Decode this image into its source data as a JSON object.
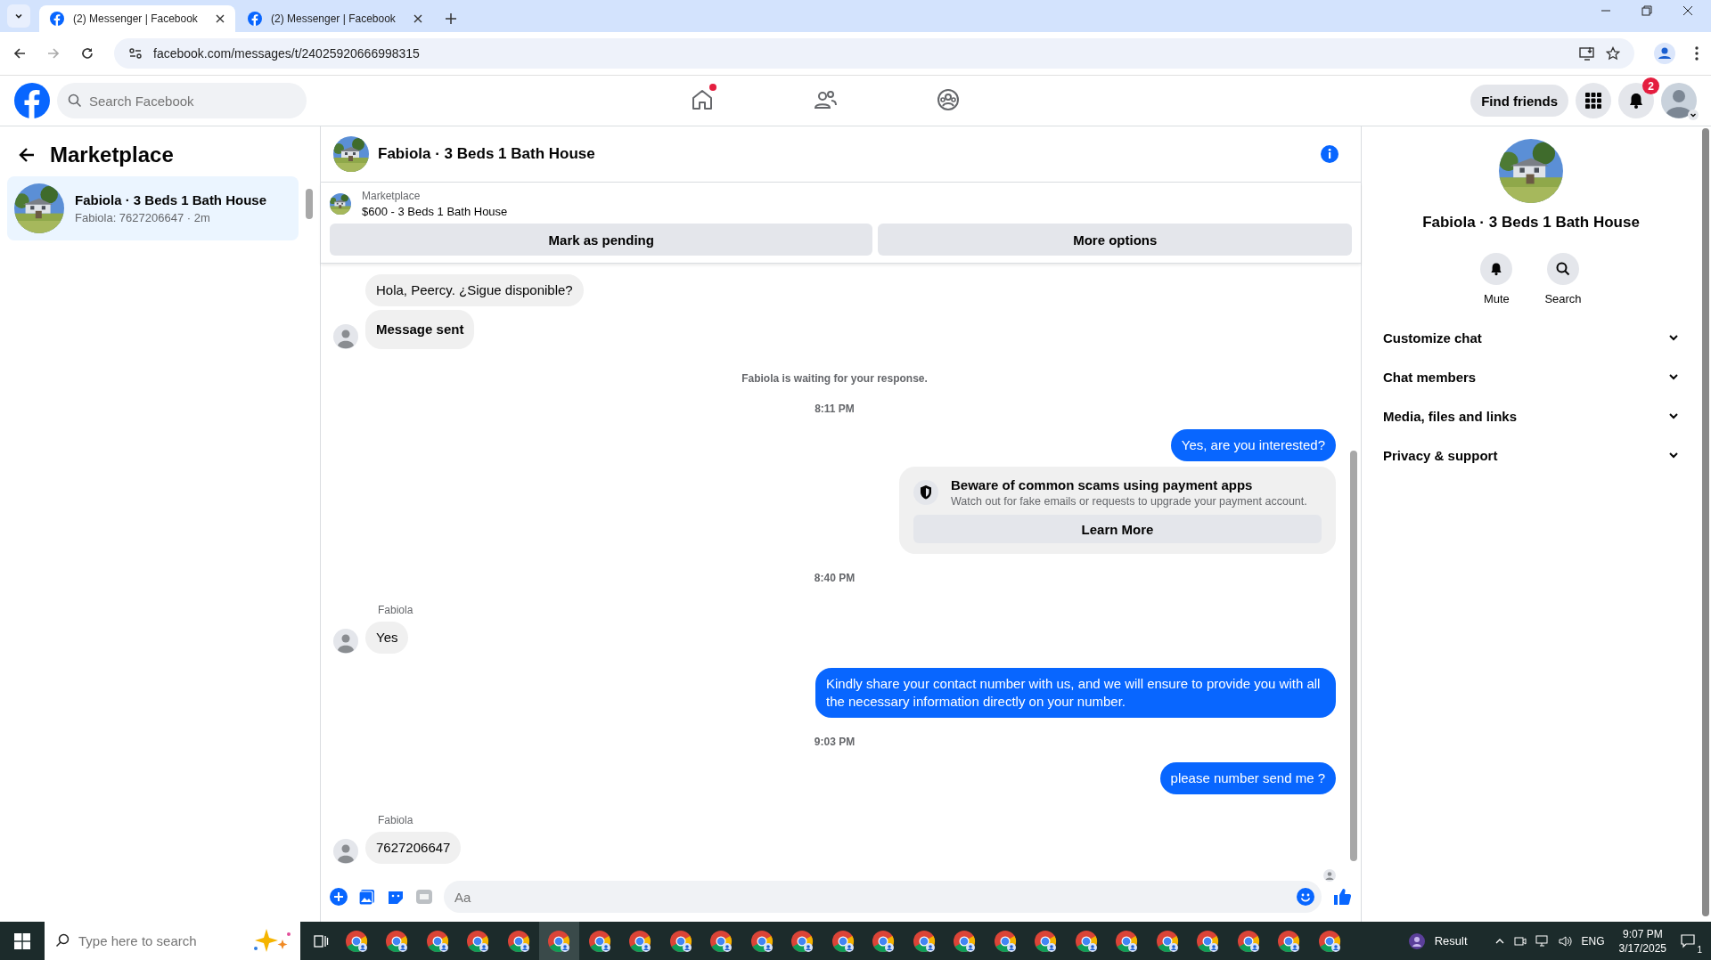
{
  "browser": {
    "tabs": [
      {
        "title": "(2) Messenger | Facebook",
        "selected": true
      },
      {
        "title": "(2) Messenger | Facebook",
        "selected": false
      }
    ],
    "url": "facebook.com/messages/t/24025920666998315"
  },
  "header": {
    "search": {
      "placeholder": "Search Facebook"
    },
    "nav": [
      {
        "kind": "home",
        "selected": false,
        "dot": true
      },
      {
        "kind": "friends",
        "selected": false,
        "dot": false
      },
      {
        "kind": "groups",
        "selected": false,
        "dot": false
      }
    ],
    "find_friends": "Find friends",
    "notifications_badge": "2"
  },
  "sidebar": {
    "title": "Marketplace",
    "conversations": [
      {
        "name": "Fabiola · 3 Beds 1 Bath House",
        "preview": "Fabiola: 7627206647 · 2m",
        "selected": true
      }
    ]
  },
  "chat": {
    "title": "Fabiola · 3 Beds 1 Bath House",
    "listing": {
      "label": "Marketplace",
      "title": "$600 - 3 Beds 1 Bath House",
      "buttons": [
        "Mark as pending",
        "More options"
      ]
    },
    "messages": [
      {
        "kind": "incoming",
        "text": "Hola, Peercy. ¿Sigue disponible?",
        "bold": false,
        "avatar": false
      },
      {
        "kind": "incoming",
        "text": "Message sent",
        "bold": true,
        "avatar": true
      },
      {
        "kind": "notice",
        "text": "Fabiola is waiting for your response."
      },
      {
        "kind": "time",
        "text": "8:11 PM"
      },
      {
        "kind": "outgoing",
        "text": "Yes, are you interested?"
      },
      {
        "kind": "warning",
        "title": "Beware of common scams using payment apps",
        "text": "Watch out for fake emails or requests to upgrade your payment account.",
        "button": "Learn More"
      },
      {
        "kind": "time",
        "text": "8:40 PM"
      },
      {
        "kind": "incoming",
        "sender": "Fabiola",
        "text": "Yes",
        "bold": false,
        "avatar": true
      },
      {
        "kind": "outgoing",
        "text": "Kindly share your contact number with us, and we will ensure to provide you with all the necessary information directly on your number."
      },
      {
        "kind": "time",
        "text": "9:03 PM"
      },
      {
        "kind": "outgoing",
        "text": "please number send me ?"
      },
      {
        "kind": "incoming",
        "sender": "Fabiola",
        "text": "7627206647",
        "bold": false,
        "avatar": true
      }
    ],
    "composer": {
      "placeholder": "Aa"
    }
  },
  "details": {
    "name": "Fabiola · 3 Beds 1 Bath House",
    "actions": [
      {
        "kind": "mute",
        "label": "Mute"
      },
      {
        "kind": "search",
        "label": "Search"
      }
    ],
    "sections": [
      {
        "label": "Customize chat",
        "expanded": false
      },
      {
        "label": "Chat members",
        "expanded": false
      },
      {
        "label": "Media, files and links",
        "expanded": false
      },
      {
        "label": "Privacy & support",
        "expanded": false
      }
    ]
  },
  "taskbar": {
    "search": {
      "placeholder": "Type here to search"
    },
    "widget": "Result",
    "language": "ENG",
    "time": "9:07 PM",
    "date": "3/17/2025",
    "notifications": "1"
  }
}
